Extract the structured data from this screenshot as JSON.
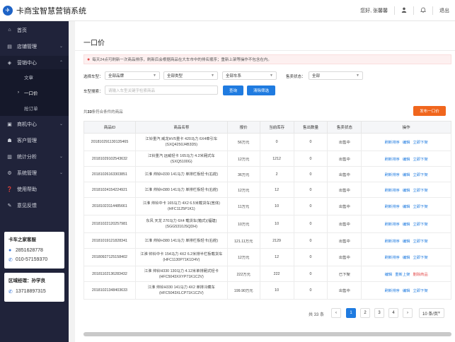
{
  "header": {
    "logo_glyph": "✈",
    "app_title": "卡商宝智慧营销系统",
    "greeting": "您好, 张馨馨",
    "user_icon": "user-icon",
    "bell_icon": "bell-icon",
    "logout_label": "退出"
  },
  "sidebar": {
    "items": [
      {
        "label": "首页",
        "icon": "⌂"
      },
      {
        "label": "店铺管理",
        "icon": "▤",
        "arrow": "⌄"
      },
      {
        "label": "营销中心",
        "icon": "◈",
        "arrow": "⌃"
      },
      {
        "label": "商机中心",
        "icon": "▣",
        "arrow": "⌄"
      },
      {
        "label": "客户管理",
        "icon": "☗"
      },
      {
        "label": "统计分析",
        "icon": "▥",
        "arrow": "⌄"
      },
      {
        "label": "系统管理",
        "icon": "⚙",
        "arrow": "⌄"
      },
      {
        "label": "使用帮助",
        "icon": "❓"
      },
      {
        "label": "意见反馈",
        "icon": "✎"
      }
    ],
    "sub_items": [
      {
        "label": "文章"
      },
      {
        "label": "一口价"
      },
      {
        "label": "抢订单"
      }
    ],
    "contact1": {
      "title": "卡车之家客服",
      "phone1": "2851628778",
      "phone2": "010-57159370"
    },
    "contact2": {
      "title": "区域经理：孙学良",
      "phone": "13718897315"
    }
  },
  "page": {
    "title": "一口价",
    "notice": "每天24点可刷新一次商品排序，刷新后会根据商品在大车市中的排名顺序；重新上架等操作不包含在内。",
    "filters": {
      "brand_label": "选择车型：",
      "brand_value": "全部品牌",
      "category_value": "全部类型",
      "series_value": "全部车系",
      "status_label": "售卖状态：",
      "status_value": "全部",
      "search_label": "车型搜索：",
      "search_placeholder": "请输入车型关键字检索商品",
      "query_button": "查询",
      "clear_button": "清除筛选"
    },
    "summary_prefix": "共",
    "summary_count": "33",
    "summary_suffix": "条符合条件的商品",
    "publish_button": "发布一口价"
  },
  "table": {
    "headers": [
      "商品ID",
      "商品名称",
      "报价",
      "当前库存",
      "售出数量",
      "售卖状态",
      "操作"
    ],
    "rows": [
      {
        "id": "20181029113013546​5",
        "name": "江铃重汽 威龙HV5重卡 420马力 6X4牵引车(SXQ4250J4B3D5)",
        "price": "56万元",
        "stock": "0",
        "sold": "0",
        "status": "出售中",
        "status_type": "on",
        "ops": [
          "刷新排序",
          "编辑",
          "立即下架"
        ]
      },
      {
        "id": "20181029102543632",
        "name": "江铃重汽 远威轻卡 165马力 4.2米厢式车(SXQ5100G)",
        "price": "12万元",
        "stock": "1212",
        "sold": "0",
        "status": "出售中",
        "status_type": "on",
        "ops": [
          "刷新排序",
          "编辑",
          "立即下架"
        ]
      },
      {
        "id": "20181026163303851",
        "name": "江淮 帅铃H330 141马力 单排栏板轻卡(右舵)",
        "price": "36万元",
        "stock": "2",
        "sold": "0",
        "status": "出售中",
        "status_type": "on",
        "ops": [
          "刷新排序",
          "编辑",
          "立即下架"
        ]
      },
      {
        "id": "20181024154224921",
        "name": "江淮 帅铃H380 141马力 单排栏板轻卡(右舵)",
        "price": "12万元",
        "stock": "12",
        "sold": "0",
        "status": "出售中",
        "status_type": "on",
        "ops": [
          "刷新排序",
          "编辑",
          "立即下架"
        ]
      },
      {
        "id": "20181023114485661",
        "name": "江淮 帅铃中卡 165马力 4X2 6.5米载货车(宽体)(HFC1125P1K1)",
        "price": "11万元",
        "stock": "10",
        "sold": "0",
        "status": "出售中",
        "status_type": "on",
        "ops": [
          "刷新排序",
          "编辑",
          "立即下架"
        ]
      },
      {
        "id": "20181022120257981",
        "name": "东风 天龙 270马力 6X4 载货车(箱式)(福建)(SGG5310JSQDH)",
        "price": "10万元",
        "stock": "10",
        "sold": "0",
        "status": "出售中",
        "status_type": "on",
        "ops": [
          "刷新排序",
          "编辑",
          "立即下架"
        ]
      },
      {
        "id": "20181019121828341",
        "name": "江淮 帅铃H380 141马力 单排栏板轻卡(右舵)",
        "price": "121.11万元",
        "stock": "2129",
        "sold": "0",
        "status": "出售中",
        "status_type": "on",
        "ops": [
          "刷新排序",
          "编辑",
          "立即下架"
        ]
      },
      {
        "id": "20180927125158402",
        "name": "江淮 帅铃中卡 154马力 4X2 6.2米排半栏板载货车(HFC1130P71K1D4V)",
        "price": "12万元",
        "stock": "12",
        "sold": "0",
        "status": "出售中",
        "status_type": "on",
        "ops": [
          "刷新排序",
          "编辑",
          "立即下架"
        ]
      },
      {
        "id": "20181102136283432",
        "name": "江淮 帅铃H330 130马力 4.12米单排厢式轻卡(HFC5043XXYP71K1C2V)",
        "price": "222万元",
        "stock": "222",
        "sold": "0",
        "status": "已下架",
        "status_type": "off",
        "ops": [
          "编辑",
          "重新上架",
          "删除商品"
        ]
      },
      {
        "id": "20181021348403633",
        "name": "江淮 帅铃H330 141马力 4X2 单排冷藏车(HFC5043XLCP71K1C2V)",
        "price": "199.90万元",
        "stock": "10",
        "sold": "0",
        "status": "出售中",
        "status_type": "on",
        "ops": [
          "刷新排序",
          "编辑",
          "立即下架"
        ]
      }
    ]
  },
  "pagination": {
    "total": "共 33 条",
    "prev": "‹",
    "pages": [
      "1",
      "2",
      "3",
      "4"
    ],
    "next": "›",
    "page_size": "10 条/页",
    "current_page": 1
  }
}
